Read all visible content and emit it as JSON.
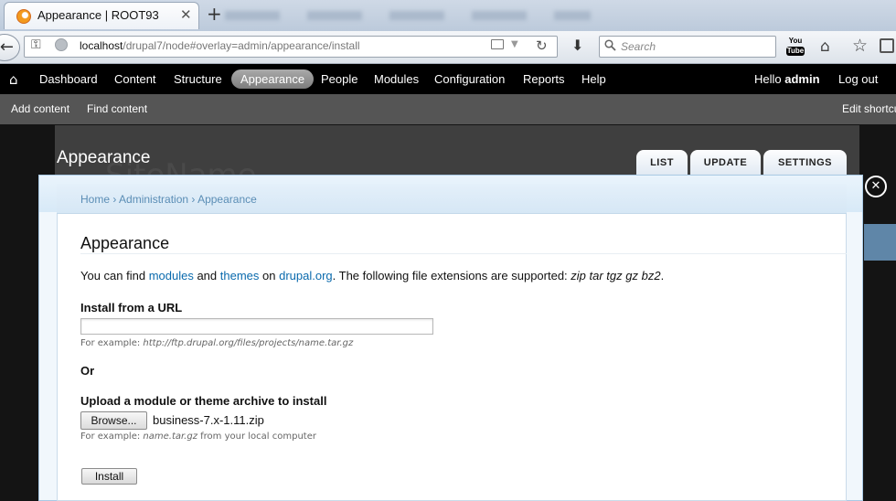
{
  "browser": {
    "tab_title": "Appearance | ROOT93",
    "tab_close": "✕",
    "new_tab": "+",
    "url_host": "localhost",
    "url_path": "/drupal7/node#overlay=admin/appearance/install",
    "search_placeholder": "Search",
    "youtube_label_top": "You",
    "youtube_label_bottom": "Tube"
  },
  "toolbar": {
    "items": [
      "Dashboard",
      "Content",
      "Structure",
      "Appearance",
      "People",
      "Modules",
      "Configuration",
      "Reports",
      "Help"
    ],
    "active": "Appearance",
    "greeting": "Hello ",
    "username": "admin",
    "logout": "Log out"
  },
  "shortcuts": {
    "add_content": "Add content",
    "find_content": "Find content",
    "edit_shortcuts": "Edit shortcuts"
  },
  "background": {
    "site_name": "SiteName"
  },
  "overlay": {
    "title": "Appearance",
    "tabs": [
      "LIST",
      "UPDATE",
      "SETTINGS"
    ],
    "close": "✕",
    "breadcrumb": [
      "Home",
      "Administration",
      "Appearance"
    ],
    "breadcrumb_sep": " › "
  },
  "page": {
    "title": "Appearance",
    "intro_prefix": "You can find ",
    "link_modules": "modules",
    "intro_and": " and ",
    "link_themes": "themes",
    "intro_on": " on ",
    "link_drupal": "drupal.org",
    "intro_suffix": ". The following file extensions are supported: ",
    "extensions": "zip tar tgz gz bz2",
    "intro_end": ".",
    "install_url_label": "Install from a URL",
    "install_url_value": "",
    "url_help_prefix": "For example: ",
    "url_help_example": "http://ftp.drupal.org/files/projects/name.tar.gz",
    "or_label": "Or",
    "upload_label": "Upload a module or theme archive to install",
    "browse_button": "Browse...",
    "file_name": "business-7.x-1.11.zip",
    "upload_help_prefix": "For example: ",
    "upload_help_example": "name.tar.gz",
    "upload_help_suffix": " from your local computer",
    "install_button": "Install"
  },
  "colors": {
    "link": "#0a6aad",
    "toolbar_bg": "#000000",
    "shortcut_bg": "#555555",
    "overlay_blue": "#a9c9e4"
  }
}
